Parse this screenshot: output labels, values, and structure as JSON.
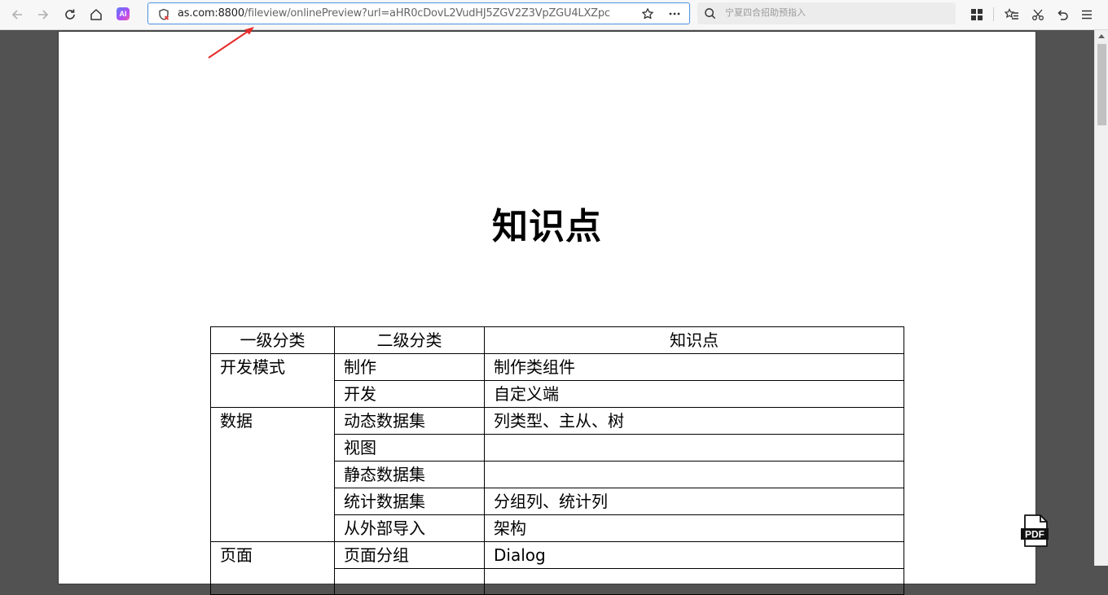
{
  "browser": {
    "url_host": "as.com:8800",
    "url_path": "/fileview/onlinePreview?url=aHR0cDovL2VudHJ5ZGV2Z3VpZGU4LXZpc",
    "search_placeholder": "宁夏四合招助预指入",
    "ai_label": "AI",
    "accent_color": "#4a90e2"
  },
  "document": {
    "title": "知识点",
    "table": {
      "headers": [
        "一级分类",
        "二级分类",
        "知识点"
      ],
      "groups": [
        {
          "level1": "开发模式",
          "rows": [
            {
              "level2": "制作",
              "point": "制作类组件"
            },
            {
              "level2": "开发",
              "point": "自定义端"
            }
          ]
        },
        {
          "level1": "数据",
          "rows": [
            {
              "level2": "动态数据集",
              "point": "列类型、主从、树"
            },
            {
              "level2": "视图",
              "point": ""
            },
            {
              "level2": "静态数据集",
              "point": ""
            },
            {
              "level2": "统计数据集",
              "point": "分组列、统计列"
            },
            {
              "level2": "从外部导入",
              "point": "架构"
            }
          ]
        },
        {
          "level1": "页面",
          "rows": [
            {
              "level2": "页面分组",
              "point": "Dialog"
            }
          ]
        }
      ]
    }
  },
  "pdf_icon_label": "PDF"
}
